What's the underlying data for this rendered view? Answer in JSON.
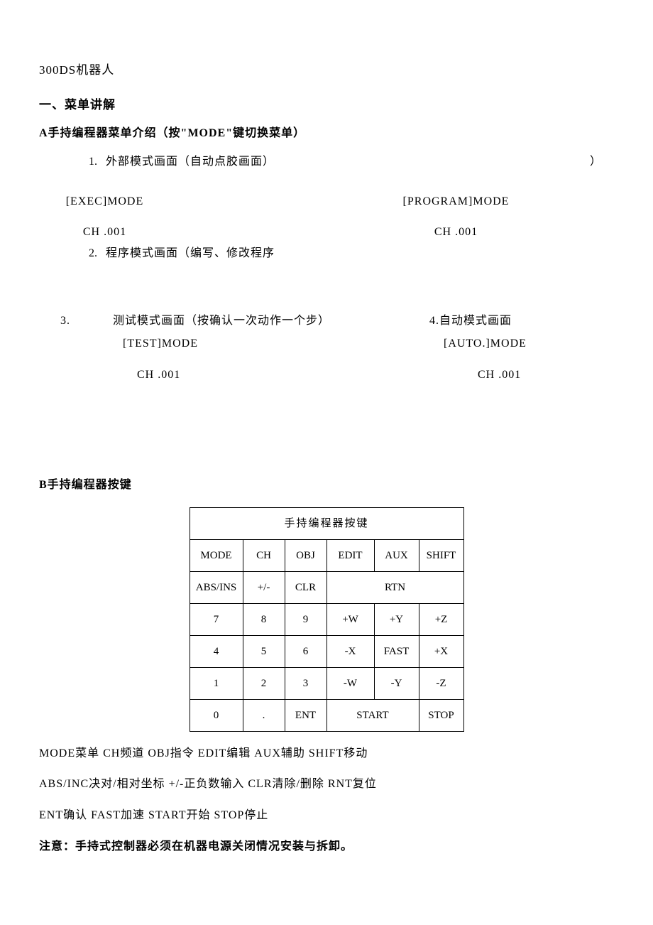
{
  "title": "300DS机器人",
  "section1_heading": "一、菜单讲解",
  "sectionA_heading": "A手持编程器菜单介绍（按\"MODE\"键切换菜单）",
  "modes": {
    "item1_num": "1.",
    "item1_desc": "外部模式画面（自动点胶画面）",
    "item1_paren": "）",
    "exec_mode": "[EXEC]MODE",
    "program_mode": "[PROGRAM]MODE",
    "ch_left": "CH .001",
    "ch_right": "CH .001",
    "item2_num": "2.",
    "item2_desc": "程序模式画面（编写、修改程序",
    "item3_num": "3.",
    "item3_desc": "测试模式画面（按确认一次动作一个步）",
    "item4_label": "4.自动模式画面",
    "test_mode": "[TEST]MODE",
    "auto_mode": "[AUTO.]MODE",
    "ch_test": "CH .001",
    "ch_auto": "CH .001"
  },
  "sectionB_heading": "B手持编程器按键",
  "table": {
    "caption": "手持编程器按键",
    "rows": [
      [
        "MODE",
        "CH",
        "OBJ",
        "EDIT",
        "AUX",
        "SHIFT"
      ],
      [
        "ABS/INS",
        "+/-",
        "CLR",
        "RTN"
      ],
      [
        "7",
        "8",
        "9",
        "+W",
        "+Y",
        "+Z"
      ],
      [
        "4",
        "5",
        "6",
        "-X",
        "FAST",
        "+X"
      ],
      [
        "1",
        "2",
        "3",
        "-W",
        "-Y",
        "-Z"
      ],
      [
        "0",
        ".",
        "ENT",
        "START",
        "STOP"
      ]
    ]
  },
  "legend": {
    "l1": "MODE菜单 CH频道 OBJ指令 EDIT编辑 AUX辅助 SHIFT移动",
    "l2": "ABS/INC决对/相对坐标    +/-正负数输入    CLR清除/删除    RNT复位",
    "l3": "ENT确认 FAST加速 START开始 STOP停止"
  },
  "note": "注意：手持式控制器必须在机器电源关闭情况安装与拆卸。"
}
